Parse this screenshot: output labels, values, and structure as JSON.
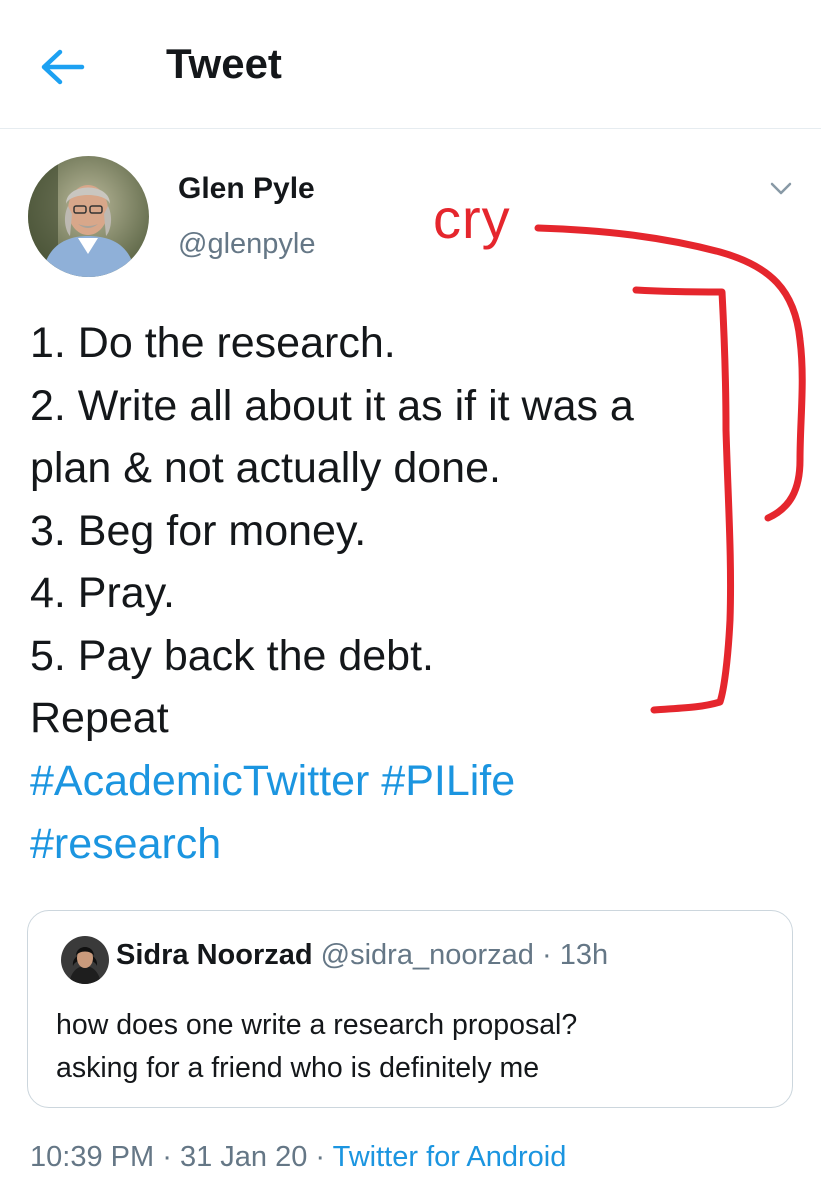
{
  "header": {
    "title": "Tweet",
    "back_icon": "arrow-left-icon",
    "accent": "#1da1f2"
  },
  "tweet": {
    "author_name": "Glen Pyle",
    "author_handle": "@glenpyle",
    "lines": [
      "1. Do the research.",
      "2. Write all about it as if it was a",
      "plan & not actually done.",
      "3. Beg for money.",
      "4. Pray.",
      "5. Pay back the debt.",
      "Repeat"
    ],
    "hashtags": [
      "#AcademicTwitter",
      "#PILife",
      "#research"
    ],
    "hashtag_color": "#1b95e0"
  },
  "quoted_tweet": {
    "author_name": "Sidra Noorzad",
    "author_handle": "@sidra_noorzad",
    "separator": "·",
    "time": "13h",
    "text_lines": [
      "how does one write a research proposal?",
      "asking for a friend who is definitely me"
    ]
  },
  "footer": {
    "time": "10:39 PM",
    "sep1": "·",
    "date": "31 Jan 20",
    "sep2": "·",
    "source": "Twitter for Android"
  },
  "annotation": {
    "text": "cry",
    "color": "#e5262d"
  }
}
